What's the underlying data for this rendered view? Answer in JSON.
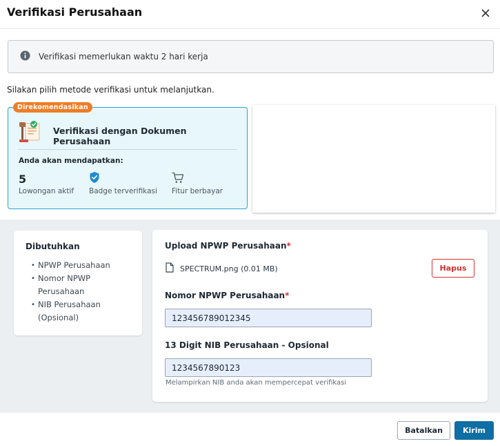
{
  "dialog": {
    "title": "Verifikasi Perusahaan",
    "close_icon": "close-icon"
  },
  "info_banner": {
    "icon": "info-icon",
    "text": "Verifikasi memerlukan waktu 2 hari kerja"
  },
  "instruction": "Silakan pilih metode verifikasi untuk melanjutkan.",
  "method_card": {
    "badge": "Direkomendasikan",
    "icon": "document-verify-icon",
    "title": "Verifikasi dengan Dokumen Perusahaan",
    "benefits_heading": "Anda akan mendapatkan:",
    "benefits": [
      {
        "value": "5",
        "label": "Lowongan aktif"
      },
      {
        "icon": "shield-check-icon",
        "label": "Badge terverifikasi"
      },
      {
        "icon": "cart-icon",
        "label": "Fitur berbayar"
      }
    ],
    "accent_color": "#2aa3cd",
    "badge_color": "#ef7d26"
  },
  "requirements": {
    "title": "Dibutuhkan",
    "items": [
      "NPWP Perusahaan",
      "Nomor NPWP Perusahaan",
      "NIB Perusahaan (Opsional)"
    ]
  },
  "form": {
    "upload_label": "Upload NPWP Perusahaan",
    "required_mark": "*",
    "file": {
      "icon": "file-icon",
      "name": "SPECTRUM.png (0.01 MB)"
    },
    "delete_label": "Hapus",
    "npwp_label": "Nomor NPWP Perusahaan",
    "npwp_value": "123456789012345",
    "nib_label": "13 Digit NIB Perusahaan - Opsional",
    "nib_value": "1234567890123",
    "nib_helper": "Melampirkan NIB anda akan mempercepat verifikasi"
  },
  "footer": {
    "cancel_label": "Batalkan",
    "submit_label": "Kirim",
    "primary_color": "#0f6ea3",
    "danger_color": "#d32f2f"
  }
}
